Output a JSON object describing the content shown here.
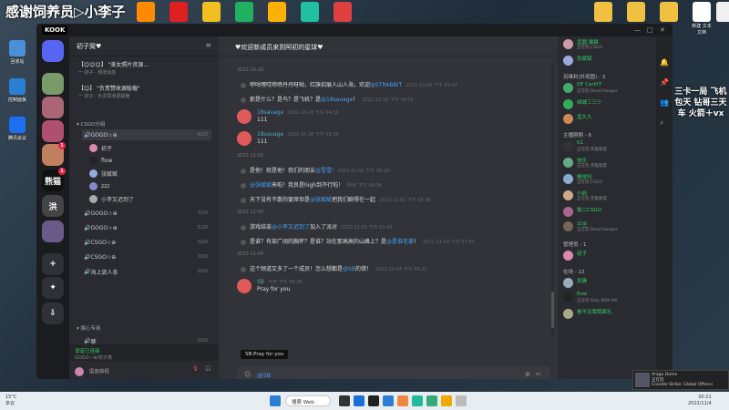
{
  "desktop": {
    "banner": "感谢饲养员▷小李子",
    "side_ad": "三卡一局 飞机包天 钻哥三天车 火箭＋vx",
    "left_icons": [
      {
        "label": "回收站",
        "color": "#4a90d9"
      },
      {
        "label": "控制面板",
        "color": "#2a7fd4"
      },
      {
        "label": "腾讯会议",
        "color": "#1d6ff2"
      }
    ],
    "top_icons": [
      {
        "label": "",
        "color": "#ff8a00"
      },
      {
        "label": "",
        "color": "#e02020"
      },
      {
        "label": "",
        "color": "#f0c020"
      },
      {
        "label": "",
        "color": "#20b060"
      },
      {
        "label": "",
        "color": "#ffb000"
      },
      {
        "label": "",
        "color": "#20c0a0"
      },
      {
        "label": "",
        "color": "#e04040"
      },
      {
        "label": "",
        "color": "#f0c040"
      },
      {
        "label": "",
        "color": "#f0c040"
      },
      {
        "label": "",
        "color": "#f0c040"
      },
      {
        "label": "新建 文本文档",
        "color": "#ffffff"
      },
      {
        "label": "",
        "color": "#f0f0f0"
      }
    ]
  },
  "app": {
    "logo": "KOOK",
    "window_controls": [
      "—",
      "□",
      "✕"
    ]
  },
  "servers": [
    {
      "label": "",
      "color": "#5865f2",
      "badge": ""
    },
    {
      "label": "",
      "color": "#7a9a6a",
      "badge": ""
    },
    {
      "label": "",
      "color": "#aa6677",
      "badge": ""
    },
    {
      "label": "",
      "color": "#b05070",
      "badge": ""
    },
    {
      "label": "",
      "color": "#c08060",
      "badge": "1"
    },
    {
      "label": "熊猫",
      "color": "#111111",
      "badge": "1"
    },
    {
      "label": "洪",
      "color": "#444444",
      "badge": ""
    },
    {
      "label": "",
      "color": "#6a5a8a",
      "badge": ""
    },
    {
      "label": "+",
      "color": "#2f3136",
      "badge": ""
    },
    {
      "label": "✦",
      "color": "#2f3136",
      "badge": ""
    },
    {
      "label": "⇩",
      "color": "#2f3136",
      "badge": ""
    }
  ],
  "channel_panel": {
    "server_name": "初子窝♥",
    "pins": [
      {
        "title": "【😊😊😊】 \"美女照片资源...",
        "sub": "一 初子 · 频道消息"
      },
      {
        "title": "【😊】 \"负责赞收源版権\"",
        "sub": "一 初子 · 负责赞收源版権"
      }
    ],
    "category1": "▾ CSGO分组",
    "channels": [
      {
        "name": "GOGO☆⊕",
        "count": "6/20"
      },
      {
        "name": "GOGO☆⊕",
        "count": "3/20"
      },
      {
        "name": "GOGO☆⊕",
        "count": "5/20"
      },
      {
        "name": "CSGO☆⊕",
        "count": "0/20"
      },
      {
        "name": "CSGO☆⊕",
        "count": "0/20"
      },
      {
        "name": "海上旅人条",
        "count": "0/20"
      }
    ],
    "voice_members": [
      {
        "name": "初子",
        "color": "#d8a"
      },
      {
        "name": "flow",
        "color": "#222"
      },
      {
        "name": "张赋赋",
        "color": "#9ad"
      },
      {
        "name": "zzz",
        "color": "#88c"
      },
      {
        "name": "小李又迟到了",
        "color": "#aaa"
      }
    ],
    "category2": "▾ 娱心专用",
    "channels2": [
      {
        "name": "聊",
        "count": "0/20"
      },
      {
        "name": "聊",
        "count": "0/20"
      }
    ],
    "voice_status": "语音已连接",
    "voice_sub": "GOGO☆⊕/初子窝",
    "user_label": "语音辨视"
  },
  "chat": {
    "title": "♥欢迎新成员来到阿初的星球♥",
    "messages": [
      {
        "type": "date",
        "text": "2022-10-28"
      },
      {
        "type": "sys",
        "pre": "咿咕嘿哎喷喷丹丹呀呦，红旗招展人山人海，欢迎",
        "mention": "@STRABBIT",
        "post": "",
        "time": "2022-10-28 下午 03:54"
      },
      {
        "type": "sys",
        "pre": "那是什么？是鸟？是飞机？是",
        "mention": "@18savage",
        "post": "！",
        "time": "2022-10-28 下午 04:05"
      },
      {
        "type": "bot",
        "name": "18savage",
        "time": "2022-10-28 下午 04:19",
        "text": "111"
      },
      {
        "type": "bot",
        "name": "18savage",
        "time": "2022-10-28 下午 05:35",
        "text": "111"
      },
      {
        "type": "date",
        "text": "2022-11-02"
      },
      {
        "type": "sys",
        "pre": "是他！就是他！我们的朋友",
        "mention": "@雪雪!",
        "post": "",
        "time": "2022-11-02 下午 08:29"
      },
      {
        "type": "sys",
        "pre": "",
        "mention": "@张赋赋",
        "post": "来啦！我良是high到不行啦！",
        "time": "昨天 下午 08:38"
      },
      {
        "type": "sys",
        "pre": "天下没有不散的宴席但是",
        "mention": "@张赋赋",
        "post": "把我们聊得在一起",
        "time": "2022-11-02 下午 08:38"
      },
      {
        "type": "date",
        "text": "2022-11-03"
      },
      {
        "type": "sys",
        "pre": "游戏结束",
        "mention": "@小李又迟到了",
        "post": "加入了派对",
        "time": "2022-11-03 下午 01:45"
      },
      {
        "type": "sys",
        "pre": "是谁？有部广阔的胸怀？是谁？站在那高高的山峰上？是",
        "mention": "@是谁老婆",
        "post": "！",
        "time": "2022-11-03 下午 07:47"
      },
      {
        "type": "date",
        "text": "2022-11-04"
      },
      {
        "type": "sys",
        "pre": "这个频道又多了一个成员！怎么想都是",
        "mention": "@SB",
        "post": "的错！",
        "time": "2022-11-04 下午 08:21"
      },
      {
        "type": "bot",
        "name": "SB",
        "time": "今天 下午 08:26",
        "text": "Pray for you"
      }
    ],
    "tooltip": "SB:Pray for you",
    "input_value": "@SB"
  },
  "members": {
    "groups": [
      {
        "title": "另维利(外观图) - 3",
        "items": [
          {
            "name": "DF CarlitT",
            "status": "正在玩 Dead Hunger",
            "color": "#4a6"
          },
          {
            "name": "绿城三三少",
            "status": "",
            "color": "#3a5"
          },
          {
            "name": "孟久九",
            "status": "",
            "color": "#c85"
          }
        ]
      },
      {
        "title": "主播刚刚 - 6",
        "items": [
          {
            "name": "K1",
            "status": "正在玩 英雄联盟",
            "color": "#333"
          },
          {
            "name": "快乐",
            "status": "正在玩 英雄联盟",
            "color": "#6a8"
          },
          {
            "name": "睡觉吗",
            "status": "正在玩 CSGO",
            "color": "#8ac"
          },
          {
            "name": "小蚂",
            "status": "正在玩 英雄联盟",
            "color": "#ca8"
          },
          {
            "name": "猫二CSGO",
            "status": "",
            "color": "#a68"
          },
          {
            "name": "平坦",
            "status": "正在玩 Dead Hunger",
            "color": "#765"
          }
        ]
      },
      {
        "title": "管理员 - 1",
        "items": [
          {
            "name": "初子",
            "status": "",
            "color": "#d8a"
          }
        ]
      },
      {
        "title": "在线 - 12",
        "items": [
          {
            "name": "发簇",
            "status": "",
            "color": "#9ab"
          },
          {
            "name": "flow",
            "status": "正在玩 Stay With Me",
            "color": "#222"
          },
          {
            "name": "看不见我我面孔",
            "status": "",
            "color": "#aa8"
          }
        ]
      }
    ],
    "top_items": [
      {
        "name": "孟圆·猫猫",
        "status": "正在玩 CSGO",
        "color": "#c9a"
      },
      {
        "name": "张赋赋",
        "status": "",
        "color": "#9ad"
      }
    ]
  },
  "taskbar": {
    "weather_temp": "15°C",
    "weather_desc": "多云",
    "search": "搜索 Web",
    "time": "20:21",
    "date": "2022/11/4",
    "toast_title": "Arago Dome",
    "toast_sub": "正在玩",
    "toast_line": "Counter-Strike: Global Offensi"
  }
}
